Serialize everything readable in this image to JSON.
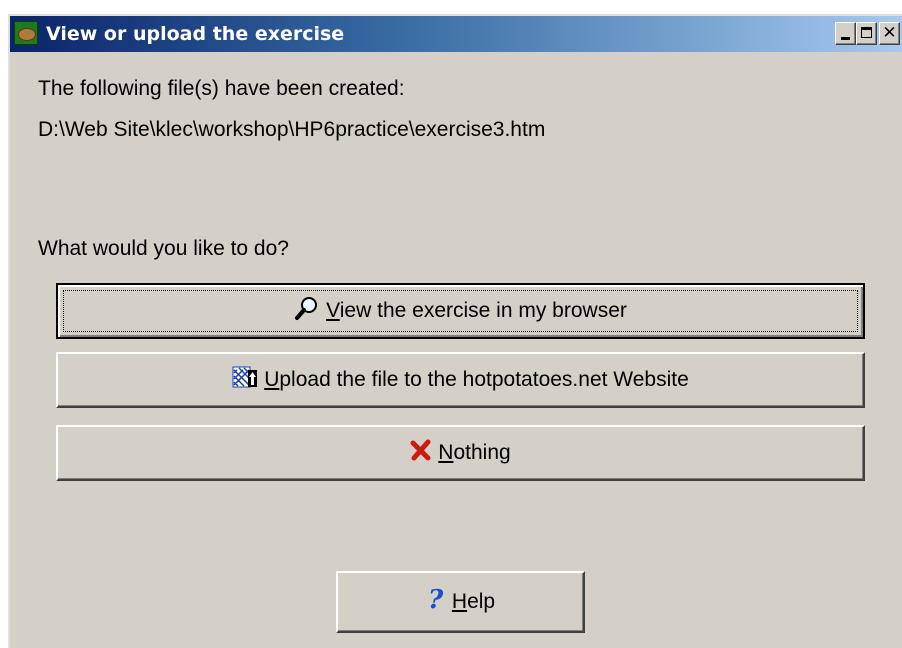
{
  "window": {
    "title": "View or upload the exercise"
  },
  "titlebar_buttons": {
    "minimize": "minimize",
    "maximize": "maximize",
    "close": "close"
  },
  "content": {
    "created_label": "The following file(s) have been created:",
    "file_path": "D:\\Web Site\\klec\\workshop\\HP6practice\\exercise3.htm",
    "question": "What would you like to do?"
  },
  "buttons": {
    "view": {
      "first": "V",
      "rest": "iew the exercise in my browser",
      "icon": "magnifier-icon"
    },
    "upload": {
      "first": "U",
      "rest": "pload the file to the hotpotatoes.net Website",
      "icon": "web-upload-icon"
    },
    "nothing": {
      "first": "N",
      "rest": "othing",
      "icon": "red-x-icon"
    },
    "help": {
      "first": "H",
      "rest": "elp",
      "icon": "question-mark-icon"
    }
  },
  "colors": {
    "title_gradient_start": "#0a246a",
    "title_gradient_end": "#a6caf0",
    "face": "#d4d0c8",
    "nothing_x": "#cc1a0f",
    "help_mark": "#1a4fd0"
  }
}
